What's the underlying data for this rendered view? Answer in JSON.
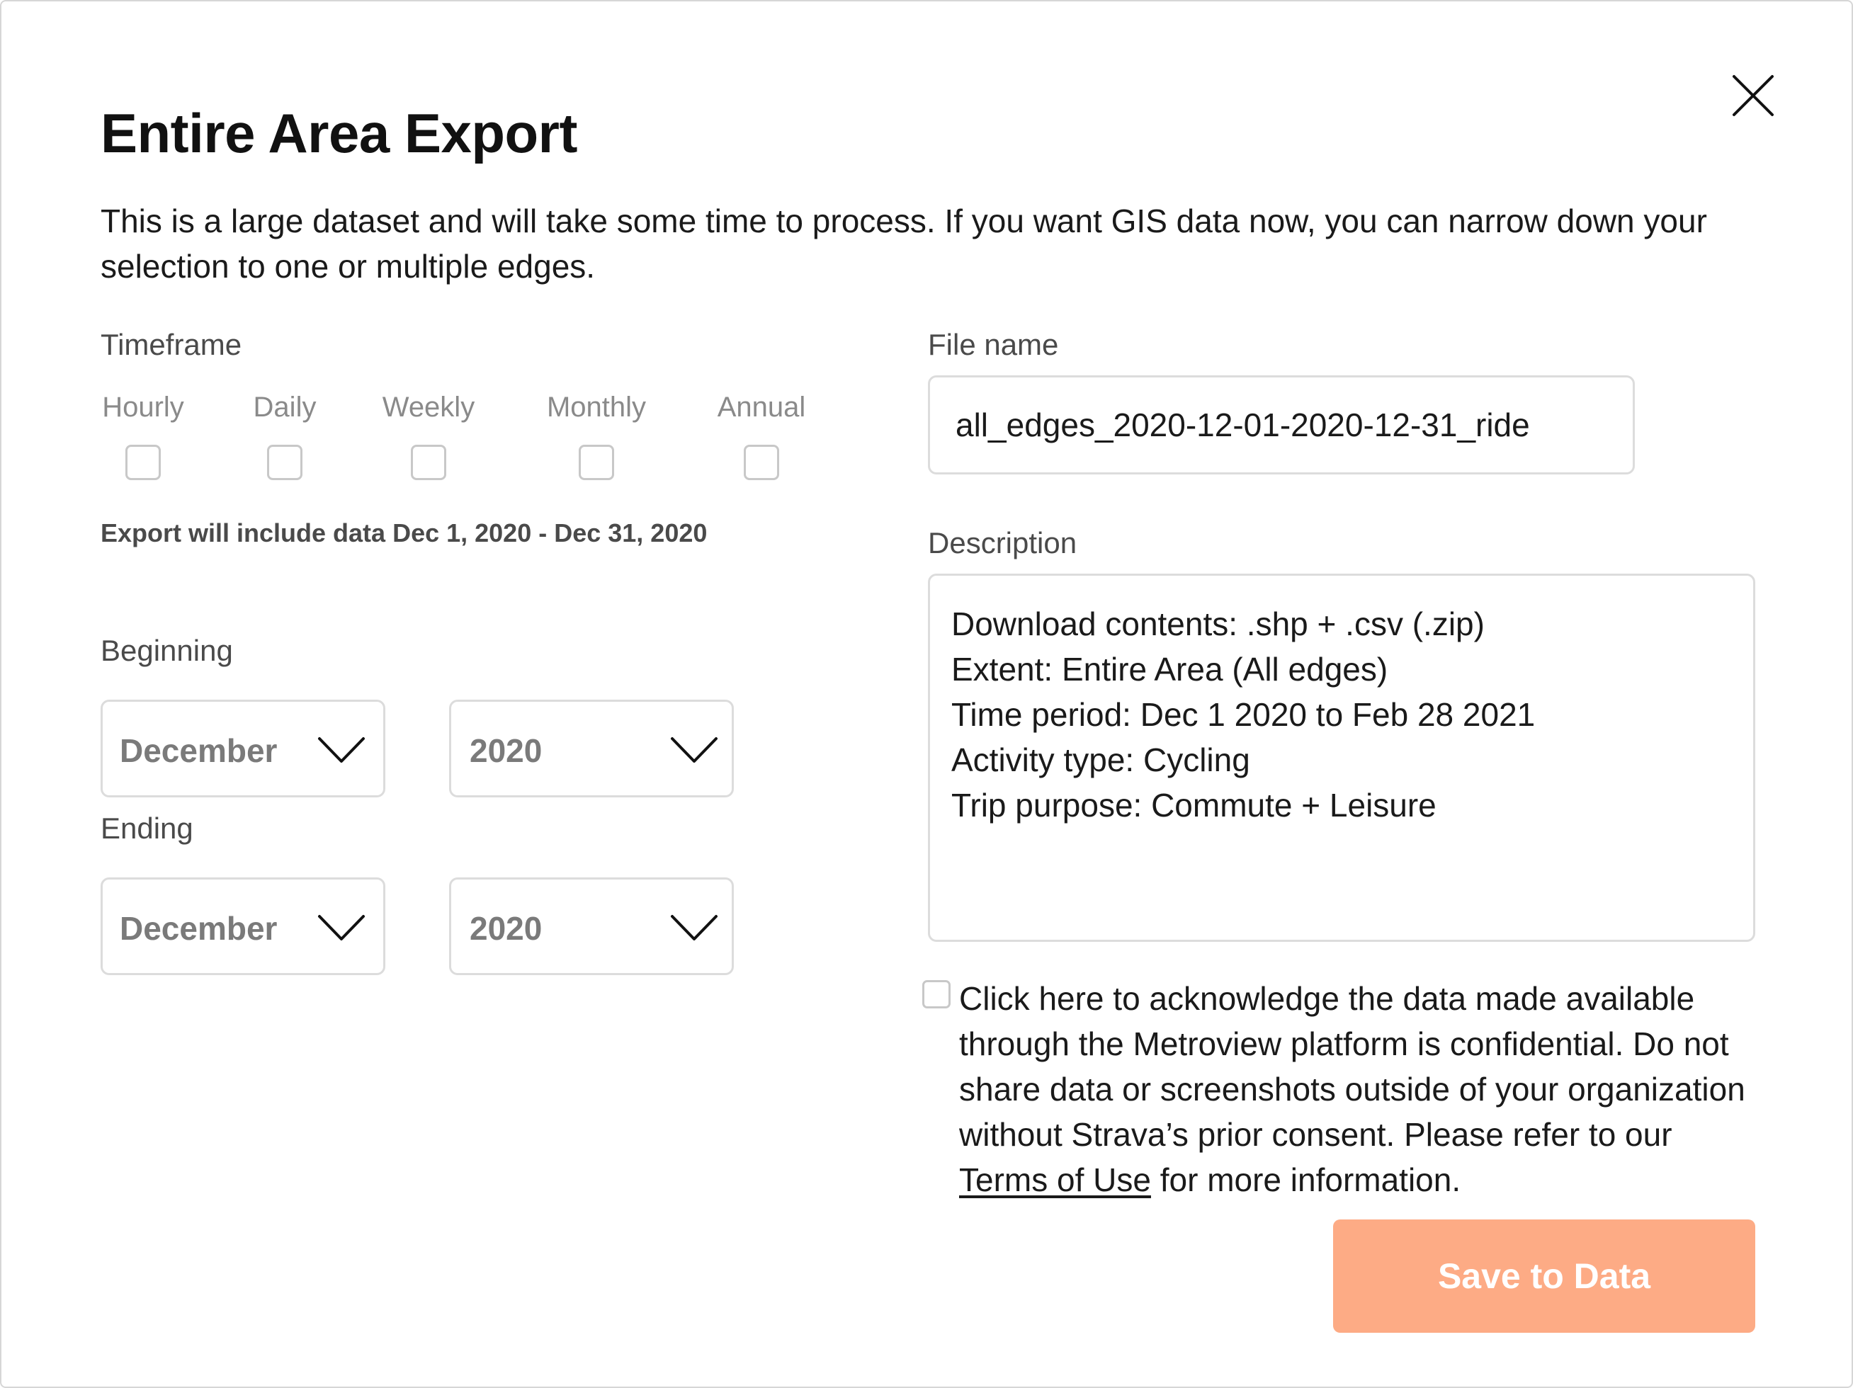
{
  "modal": {
    "title": "Entire Area Export",
    "intro": "This is a large dataset and will take some time to process. If you want GIS data now, you can narrow down your selection to one or multiple edges.",
    "close_icon": "close-icon"
  },
  "timeframe": {
    "label": "Timeframe",
    "options": [
      {
        "label": "Hourly",
        "checked": false
      },
      {
        "label": "Daily",
        "checked": false
      },
      {
        "label": "Weekly",
        "checked": false
      },
      {
        "label": "Monthly",
        "checked": false
      },
      {
        "label": "Annual",
        "checked": false
      }
    ],
    "export_note": "Export will include data Dec 1, 2020 - Dec 31, 2020"
  },
  "beginning": {
    "label": "Beginning",
    "month": "December",
    "year": "2020"
  },
  "ending": {
    "label": "Ending",
    "month": "December",
    "year": "2020"
  },
  "file_name": {
    "label": "File name",
    "value": "all_edges_2020-12-01-2020-12-31_ride"
  },
  "description": {
    "label": "Description",
    "lines": [
      "Download contents: .shp + .csv (.zip)",
      "Extent: Entire Area (All edges)",
      "Time period: Dec 1 2020 to Feb 28 2021",
      "Activity type: Cycling",
      "Trip purpose: Commute + Leisure"
    ]
  },
  "acknowledgement": {
    "checked": false,
    "text_before": "Click here to acknowledge the data made available through the Metroview platform is confidential. Do not share data or screenshots outside of your organization without Strava’s prior consent. Please refer to our ",
    "link_text": "Terms of Use",
    "text_after": " for more information."
  },
  "actions": {
    "save_label": "Save to Data",
    "save_color": "#fdab85"
  }
}
